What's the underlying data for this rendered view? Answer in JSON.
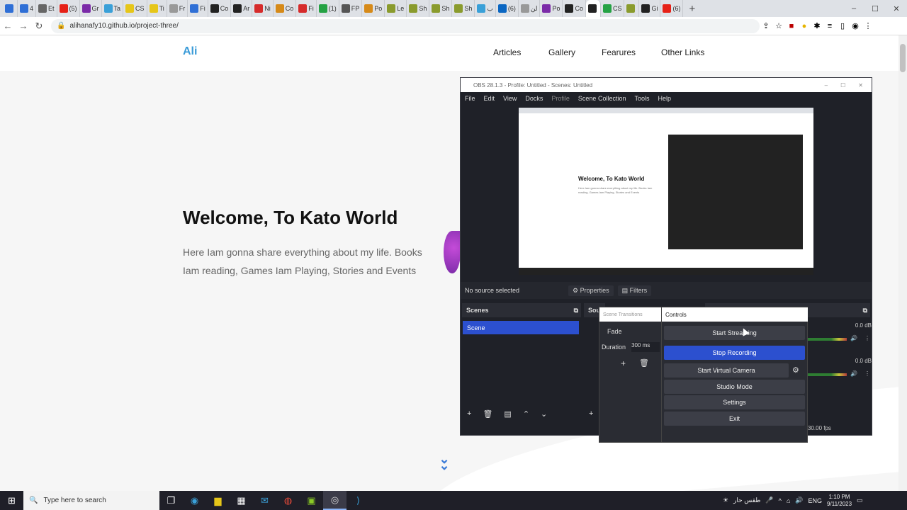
{
  "browser": {
    "tabs": [
      {
        "label": "",
        "color": "#2f6fd6"
      },
      {
        "label": "4",
        "color": "#2f6fd6"
      },
      {
        "label": "Et",
        "color": "#666"
      },
      {
        "label": "(5)",
        "color": "#e62117"
      },
      {
        "label": "Gr",
        "color": "#7b2ba8"
      },
      {
        "label": "Ta",
        "color": "#3aa0d8"
      },
      {
        "label": "CS",
        "color": "#e6c619"
      },
      {
        "label": "Ti",
        "color": "#e6c619"
      },
      {
        "label": "Fr",
        "color": "#999"
      },
      {
        "label": "Fi",
        "color": "#2f6fd6"
      },
      {
        "label": "Co",
        "color": "#222"
      },
      {
        "label": "Ar",
        "color": "#222"
      },
      {
        "label": "Ni",
        "color": "#d62b2b"
      },
      {
        "label": "Co",
        "color": "#d68a19"
      },
      {
        "label": "Fi",
        "color": "#d62b2b"
      },
      {
        "label": "(1)",
        "color": "#25a244"
      },
      {
        "label": "FP",
        "color": "#555"
      },
      {
        "label": "Po",
        "color": "#d68a19"
      },
      {
        "label": "Le",
        "color": "#8a9b2d"
      },
      {
        "label": "Sh",
        "color": "#8a9b2d"
      },
      {
        "label": "Sh",
        "color": "#8a9b2d"
      },
      {
        "label": "Sh",
        "color": "#8a9b2d"
      },
      {
        "label": "ب",
        "color": "#3aa0d8"
      },
      {
        "label": "(6)",
        "color": "#0a66c2"
      },
      {
        "label": "لن",
        "color": "#999"
      },
      {
        "label": "Po",
        "color": "#7b2ba8"
      },
      {
        "label": "Co",
        "color": "#222"
      },
      {
        "label": "",
        "color": "#222",
        "active": true
      },
      {
        "label": "CS",
        "color": "#25a244"
      },
      {
        "label": "",
        "color": "#8a9b2d"
      },
      {
        "label": "Gi",
        "color": "#222"
      },
      {
        "label": "(6)",
        "color": "#e62117"
      }
    ],
    "new_tab": "+",
    "url": "alihanafy10.github.io/project-three/"
  },
  "site": {
    "logo": "Ali",
    "nav": [
      "Articles",
      "Gallery",
      "Fearures",
      "Other Links"
    ],
    "hero_title": "Welcome, To Kato World",
    "hero_desc": "Here Iam gonna share everything about my life. Books Iam reading, Games Iam Playing, Stories and Events",
    "scroll_glyph": "⌄⌄"
  },
  "obs": {
    "title": "OBS 28.1.3 - Profile: Untitled - Scenes: Untitled",
    "menu": [
      "File",
      "Edit",
      "View",
      "Docks",
      "Profile",
      "Scene Collection",
      "Tools",
      "Help"
    ],
    "preview_title": "Welcome, To Kato World",
    "preview_text": "Here Iam gonna share everything about my life. Books Iam reading, Games Iam Playing, Stories and Events",
    "no_source": "No source selected",
    "properties": "Properties",
    "filters": "Filters",
    "scenes_header": "Scenes",
    "scene_item": "Scene",
    "sources_header": "Sou",
    "transitions_header": "Scene Transitions",
    "fade": "Fade",
    "duration_label": "Duration",
    "duration_value": "300 ms",
    "controls_header": "Controls",
    "buttons": {
      "start_streaming": "Start Streaming",
      "stop_recording": "Stop Recording",
      "start_virtual_camera": "Start Virtual Camera",
      "studio_mode": "Studio Mode",
      "settings": "Settings",
      "exit": "Exit"
    },
    "meter_db_1": "0.0 dB",
    "meter_db_2": "0.0 dB",
    "fps": "30.00 fps"
  },
  "taskbar": {
    "search_placeholder": "Type here to search",
    "keyboard_layout": "طقس حار",
    "lang": "ENG",
    "time": "1:10 PM",
    "date": "9/11/2023"
  }
}
